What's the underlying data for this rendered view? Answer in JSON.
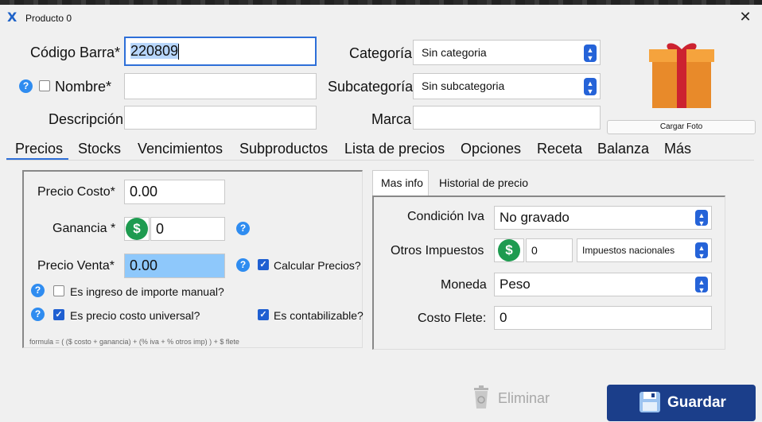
{
  "window": {
    "title": "Producto 0",
    "close_glyph": "✕"
  },
  "form": {
    "codigo_barra_label": "Código Barra*",
    "codigo_barra_value": "220809",
    "nombre_label": "Nombre*",
    "nombre_value": "",
    "descripcion_label": "Descripción",
    "descripcion_value": "",
    "categoria_label": "Categoría",
    "categoria_value": "Sin categoria",
    "subcategoria_label": "Subcategoría",
    "subcategoria_value": "Sin subcategoria",
    "marca_label": "Marca",
    "marca_value": "",
    "cargar_foto": "Cargar Foto"
  },
  "tabs": [
    "Precios",
    "Stocks",
    "Vencimientos",
    "Subproductos",
    "Lista de precios",
    "Opciones",
    "Receta",
    "Balanza",
    "Más"
  ],
  "precios": {
    "costo_label": "Precio Costo*",
    "costo_value": "0.00",
    "ganancia_label": "Ganancia *",
    "ganancia_value": "0",
    "venta_label": "Precio Venta*",
    "venta_value": "0.00",
    "calcular_label": "Calcular Precios?",
    "ingreso_manual_label": "Es ingreso de importe manual?",
    "costo_universal_label": "Es precio costo universal?",
    "contabilizable_label": "Es contabilizable?",
    "formula": "formula = ( ($ costo + ganancia) + (% iva + % otros imp) ) + $ flete",
    "dollar": "$",
    "help": "?"
  },
  "subtabs": [
    "Mas info",
    "Historial de precio"
  ],
  "masinfo": {
    "condicion_label": "Condición Iva",
    "condicion_value": "No gravado",
    "otros_label": "Otros Impuestos",
    "otros_value": "0",
    "otros_tipo": "Impuestos nacionales",
    "moneda_label": "Moneda",
    "moneda_value": "Peso",
    "flete_label": "Costo Flete:",
    "flete_value": "0"
  },
  "actions": {
    "eliminar": "Eliminar",
    "guardar": "Guardar"
  },
  "colors": {
    "accent": "#2e6fd8",
    "save_button": "#1b3e8a",
    "money": "#1e9b50",
    "help": "#2f8cf0"
  },
  "icons": [
    "app-logo-icon",
    "close-icon",
    "help-icon",
    "dollar-icon",
    "spin-icon",
    "gift-icon",
    "recycle-bin-icon",
    "floppy-disk-icon",
    "check-icon"
  ]
}
